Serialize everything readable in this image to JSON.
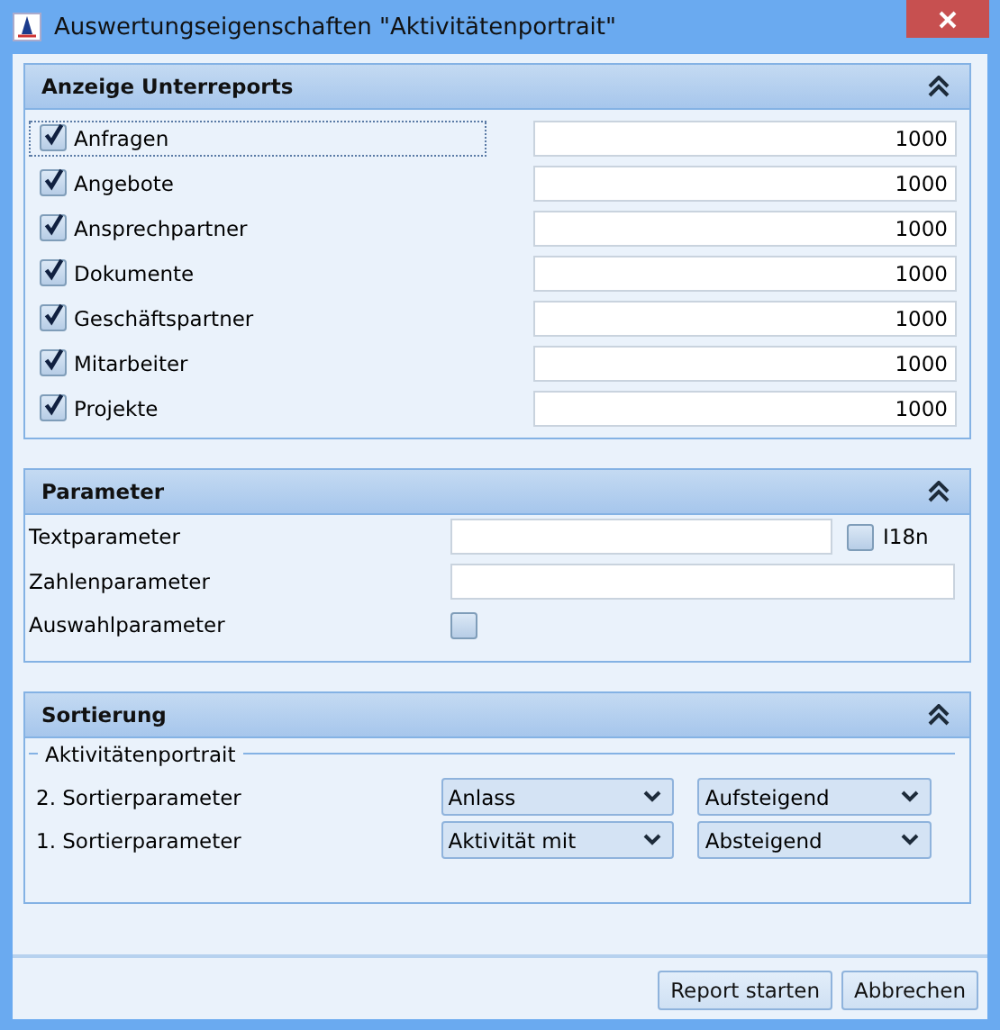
{
  "window": {
    "title": "Auswertungseigenschaften \"Aktivitätenportrait\""
  },
  "sections": [
    {
      "title": "Anzeige Unterreports",
      "expanded": true,
      "kind": "subreports",
      "rows": [
        {
          "label": "Anfragen",
          "checked": true,
          "focused": true,
          "value": "1000"
        },
        {
          "label": "Angebote",
          "checked": true,
          "focused": false,
          "value": "1000"
        },
        {
          "label": "Ansprechpartner",
          "checked": true,
          "focused": false,
          "value": "1000"
        },
        {
          "label": "Dokumente",
          "checked": true,
          "focused": false,
          "value": "1000"
        },
        {
          "label": "Geschäftspartner",
          "checked": true,
          "focused": false,
          "value": "1000"
        },
        {
          "label": "Mitarbeiter",
          "checked": true,
          "focused": false,
          "value": "1000"
        },
        {
          "label": "Projekte",
          "checked": true,
          "focused": false,
          "value": "1000"
        }
      ]
    },
    {
      "title": "Parameter",
      "expanded": true,
      "kind": "parameters",
      "rows": [
        {
          "kind": "text",
          "label": "Textparameter",
          "option": {
            "label": "I18n",
            "checked": false
          }
        },
        {
          "kind": "number",
          "label": "Zahlenparameter"
        },
        {
          "kind": "choice",
          "label": "Auswahlparameter",
          "checked": false
        }
      ]
    },
    {
      "title": "Sortierung",
      "expanded": true,
      "kind": "sorting",
      "group": "Aktivitätenportrait",
      "rows": [
        {
          "label": "2. Sortierparameter",
          "field": "Anlass",
          "order": "Aufsteigend"
        },
        {
          "label": "1. Sortierparameter",
          "field": "Aktivität mit",
          "order": "Absteigend"
        }
      ]
    }
  ],
  "buttons": [
    "Report starten",
    "Abbrechen"
  ]
}
